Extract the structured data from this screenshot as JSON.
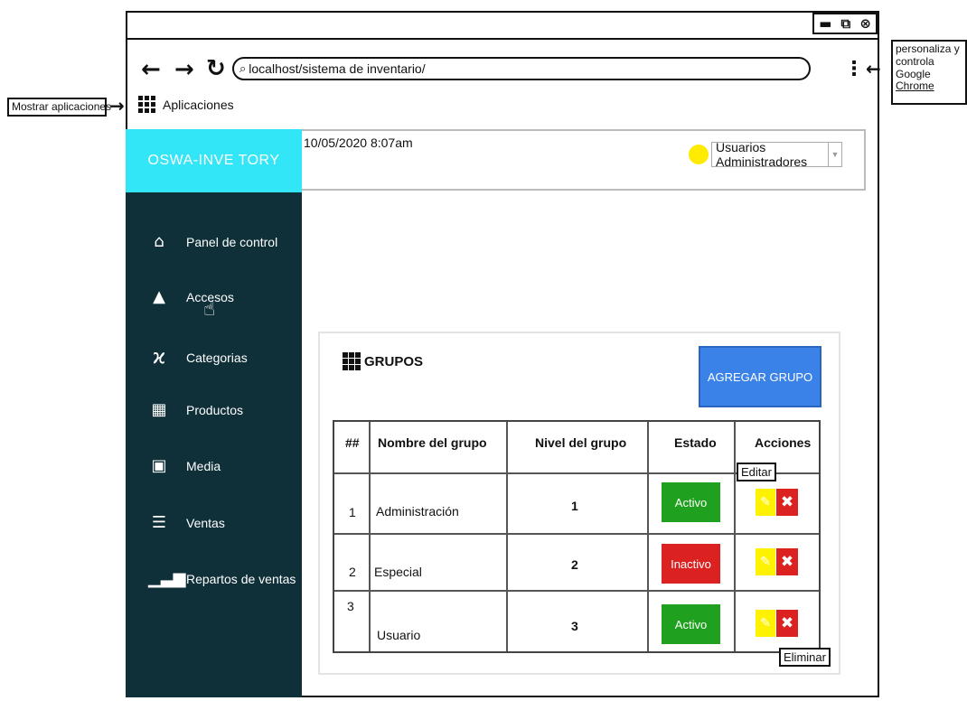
{
  "window": {
    "controls": [
      "▬",
      "⧉",
      "⊗"
    ]
  },
  "browser": {
    "url": "localhost/sistema de inventario/",
    "apps_label": "Aplicaciones",
    "back_glyph": "←",
    "forward_glyph": "→",
    "reload_glyph": "↻",
    "menu_glyph": "⋮"
  },
  "annotations": {
    "show_apps": "Mostrar aplicaciones",
    "customize_line1": "personaliza y",
    "customize_line2": "controla Google",
    "customize_line3": "Chrome",
    "edit_tip": "Editar",
    "delete_tip": "Eliminar"
  },
  "app": {
    "brand": "OSWA-INVE TORY",
    "datetime": "10/05/2020 8:07am",
    "user_role": "Usuarios Administradores"
  },
  "sidebar": {
    "items": [
      {
        "label": "Panel de control",
        "icon": "home-icon"
      },
      {
        "label": "Accesos",
        "icon": "user-icon"
      },
      {
        "label": "Categorias",
        "icon": "xing-icon"
      },
      {
        "label": "Productos",
        "icon": "grid-icon"
      },
      {
        "label": "Media",
        "icon": "image-icon"
      },
      {
        "label": "Ventas",
        "icon": "list-icon"
      },
      {
        "label": "Repartos de ventas",
        "icon": "signal-icon"
      }
    ]
  },
  "groups": {
    "title": "GRUPOS",
    "add_button": "AGREGAR GRUPO",
    "columns": [
      "##",
      "Nombre del grupo",
      "Nivel del grupo",
      "Estado",
      "Acciones"
    ],
    "rows": [
      {
        "id": "1",
        "name": "Administración",
        "level": "1",
        "status": "Activo"
      },
      {
        "id": "2",
        "name": "Especial",
        "level": "2",
        "status": "Inactivo"
      },
      {
        "id": "3",
        "name": "Usuario",
        "level": "3",
        "status": "Activo"
      }
    ]
  },
  "colors": {
    "brand_bg": "#33e6f7",
    "sidebar_bg": "#0f2f39",
    "add_button_bg": "#3b82e8",
    "active": "#1fa01f",
    "inactive": "#dc2121",
    "edit": "#fff200",
    "user_dot": "#ffeb00"
  }
}
